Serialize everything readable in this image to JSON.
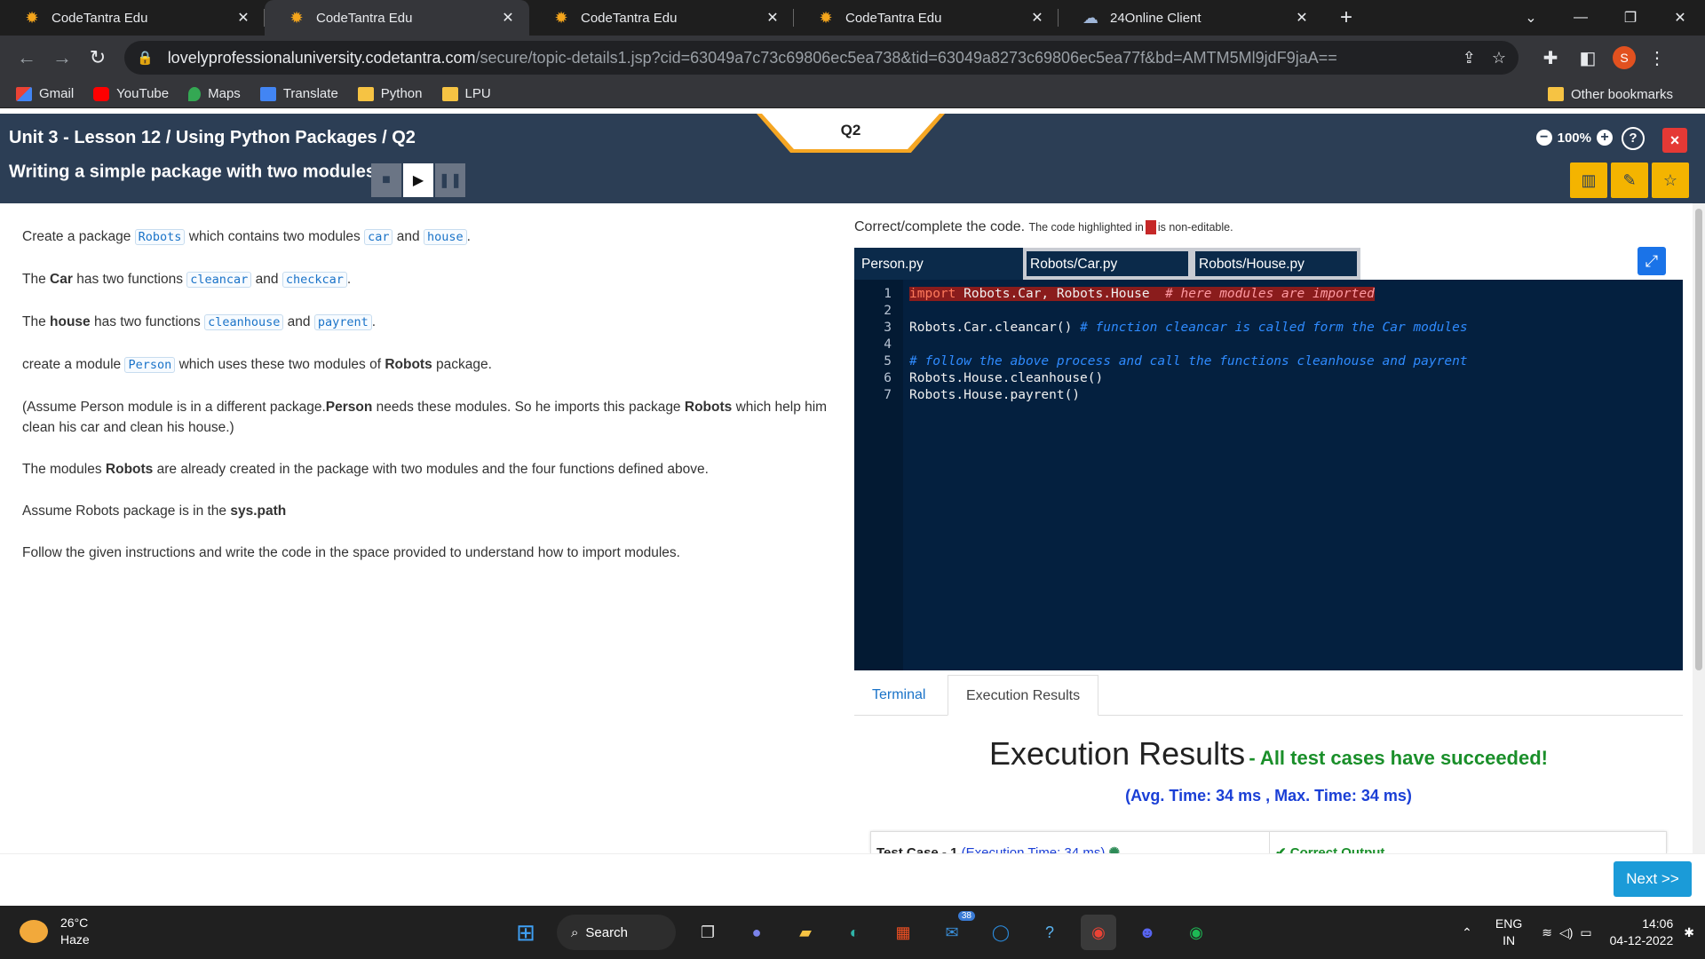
{
  "browser": {
    "tabs": [
      {
        "title": "CodeTantra Edu",
        "active": false
      },
      {
        "title": "CodeTantra Edu",
        "active": true
      },
      {
        "title": "CodeTantra Edu",
        "active": false
      },
      {
        "title": "CodeTantra Edu",
        "active": false
      },
      {
        "title": "24Online Client",
        "active": false
      }
    ],
    "url_host": "lovelyprofessionaluniversity.codetantra.com",
    "url_path": "/secure/topic-details1.jsp?cid=63049a7c73c69806ec5ea738&tid=63049a8273c69806ec5ea77f&bd=AMTM5Ml9jdF9jaA==",
    "profile_initial": "S",
    "bookmarks": [
      "Gmail",
      "YouTube",
      "Maps",
      "Translate",
      "Python",
      "LPU"
    ],
    "other_bookmarks": "Other bookmarks"
  },
  "header": {
    "breadcrumb": "Unit 3 - Lesson 12 / Using Python Packages / Q2",
    "lesson_title": "Writing a simple package with two modules",
    "question_tab": "Q2",
    "zoom": "100%",
    "help": "?",
    "close": "×"
  },
  "question": {
    "p1_pre": "Create a package",
    "p1_chip1": "Robots",
    "p1_mid": "which contains two modules",
    "p1_chip2": "car",
    "p1_and": "and",
    "p1_chip3": "house",
    "p1_end": ".",
    "p2_pre": "The",
    "p2_bold": "Car",
    "p2_mid": "has two functions",
    "p2_chip1": "cleancar",
    "p2_and": "and",
    "p2_chip2": "checkcar",
    "p2_end": ".",
    "p3_pre": "The",
    "p3_bold": "house",
    "p3_mid": "has two functions",
    "p3_chip1": "cleanhouse",
    "p3_and": "and",
    "p3_chip2": "payrent",
    "p3_end": ".",
    "p4_pre": "create a module",
    "p4_chip": "Person",
    "p4_mid": "which uses these two modules of",
    "p4_bold": "Robots",
    "p4_end": "package.",
    "p5_a": "(Assume Person module is in a different package.",
    "p5_b1": "Person",
    "p5_c": " needs these modules. So he imports this package ",
    "p5_b2": "Robots",
    "p5_d": " which help him clean his car and clean his house.)",
    "p6_a": "The modules",
    "p6_b": "Robots",
    "p6_c": "are already created in the package with two modules and the four functions defined above.",
    "p7_a": "Assume Robots package is in the",
    "p7_b": "sys.path",
    "p8": "Follow the given instructions and write the code in the space provided to understand how to import modules."
  },
  "editor": {
    "note": "Correct/complete the code.",
    "note_small_a": "The code highlighted in",
    "note_small_b": "is non-editable.",
    "files": [
      "Person.py",
      "Robots/Car.py",
      "Robots/House.py"
    ],
    "lines": [
      {
        "n": "1",
        "kw": "import",
        "code": " Robots.Car, Robots.House  ",
        "comment": "# here modules are imported",
        "locked": true
      },
      {
        "n": "2",
        "kw": "",
        "code": "",
        "comment": "",
        "locked": false
      },
      {
        "n": "3",
        "kw": "",
        "code": "Robots.Car.cleancar() ",
        "comment": "# function cleancar is called form the Car modules",
        "locked": false
      },
      {
        "n": "4",
        "kw": "",
        "code": "",
        "comment": "",
        "locked": false
      },
      {
        "n": "5",
        "kw": "",
        "code": "",
        "comment": "# follow the above process and call the functions cleanhouse and payrent",
        "locked": false
      },
      {
        "n": "6",
        "kw": "",
        "code": "Robots.House.cleanhouse()",
        "comment": "",
        "locked": false
      },
      {
        "n": "7",
        "kw": "",
        "code": "Robots.House.payrent()",
        "comment": "",
        "locked": false
      }
    ]
  },
  "results": {
    "tabs": [
      "Terminal",
      "Execution Results"
    ],
    "title": "Execution Results",
    "status": "- All test cases have succeeded!",
    "avg_time": "(Avg. Time: 34 ms , Max. Time: 34 ms)",
    "testcase_label": "Test Case - 1",
    "testcase_time": "(Execution Time: 34 ms)",
    "testcase_output": "✔ Correct Output"
  },
  "next_button": "Next >>",
  "taskbar": {
    "temp": "26°C",
    "condition": "Haze",
    "search": "Search",
    "badge_count": "38",
    "lang_top": "ENG",
    "lang_bottom": "IN",
    "time": "14:06",
    "date": "04-12-2022"
  }
}
